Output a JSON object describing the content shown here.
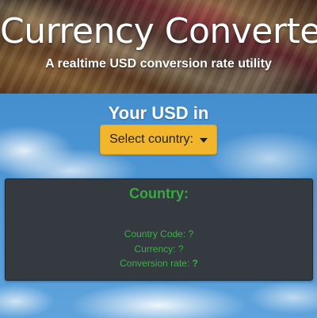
{
  "header": {
    "title": "Currency Converter",
    "subtitle": "A realtime USD conversion rate utility"
  },
  "converter": {
    "heading": "Your USD in",
    "dropdown_label": "Select country:",
    "dropdown_icon": "caret-down-icon"
  },
  "result": {
    "title": "Country:",
    "country_code_label": "Country Code:",
    "country_code_value": "?",
    "currency_label": "Currency:",
    "currency_value": "?",
    "rate_label": "Conversion rate:",
    "rate_value": "?"
  },
  "colors": {
    "dropdown_bg": "#f2b62d",
    "card_bg": "#343a40",
    "card_text": "#3fae4b",
    "sky": "#4a93d2"
  }
}
